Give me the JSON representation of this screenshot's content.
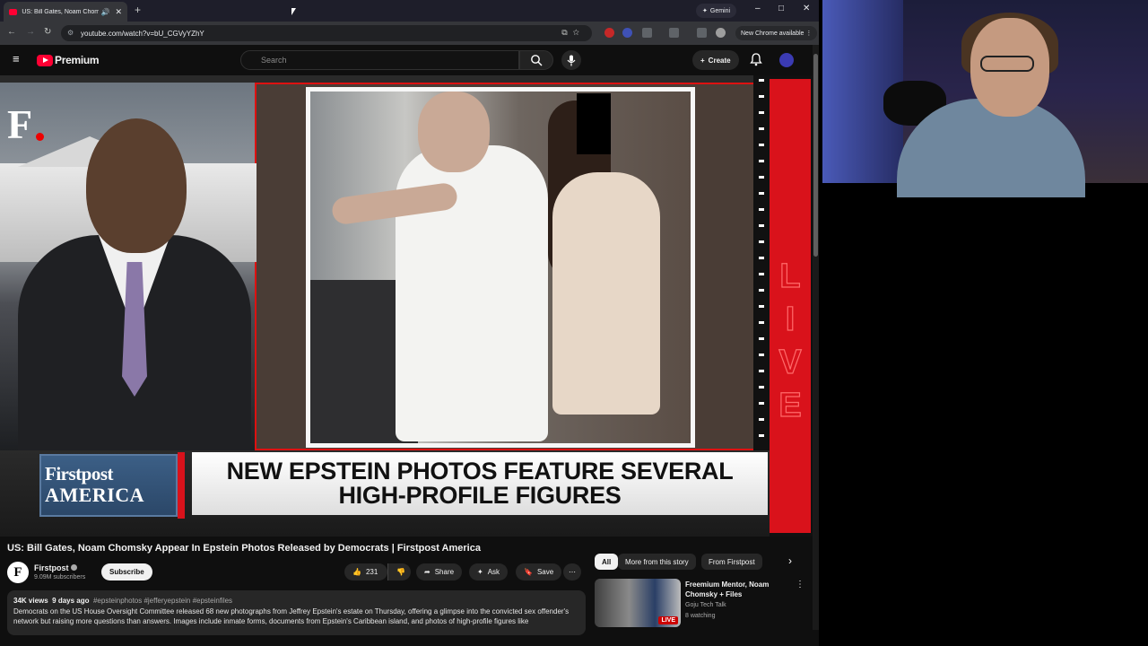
{
  "browser": {
    "tab_title": "US: Bill Gates, Noam Chom",
    "new_tab": "+",
    "gemini_label": "Gemini",
    "url": "youtube.com/watch?v=bU_CGVyYZhY",
    "new_chrome_label": "New Chrome available",
    "window_controls": [
      "–",
      "□",
      "✕"
    ],
    "nav": [
      "←",
      "→",
      "↻"
    ]
  },
  "youtube": {
    "logo_text": "Premium",
    "search_placeholder": "Search",
    "create_label": "Create"
  },
  "player": {
    "network_logo_letter": "F",
    "brand_line1": "Firstpost",
    "brand_line2": "AMERICA",
    "headline_line1": "NEW EPSTEIN PHOTOS FEATURE SEVERAL",
    "headline_line2": "HIGH-PROFILE FIGURES",
    "live_letters": "LIVE"
  },
  "video": {
    "title": "US: Bill Gates, Noam Chomsky Appear In Epstein Photos Released by Democrats | Firstpost America",
    "channel_initial": "F",
    "channel_name": "Firstpost",
    "subscribers": "9.09M subscribers",
    "subscribe_label": "Subscribe",
    "likes": "231",
    "share_label": "Share",
    "ask_label": "Ask",
    "save_label": "Save",
    "more_label": "⋯",
    "views": "34K views",
    "age": "9 days ago",
    "hashtags": "#epsteinphotos #jefferyepstein #epsteinfiles",
    "description": "Democrats on the US House Oversight Committee released 68 new photographs from Jeffrey Epstein's estate on Thursday, offering a glimpse into the convicted sex offender's network but raising more questions than answers. Images include inmate forms, documents from Epstein's Caribbean island, and photos of high-profile figures like"
  },
  "sidebar": {
    "chips": [
      {
        "label": "All"
      },
      {
        "label": "More from this story"
      },
      {
        "label": "From Firstpost"
      }
    ],
    "next_arrow": "›",
    "recommendation": {
      "title": "Freemium Mentor, Noam Chomsky + Files",
      "channel": "Goju Tech Talk",
      "watching": "8 watching",
      "badge": "LIVE"
    }
  }
}
